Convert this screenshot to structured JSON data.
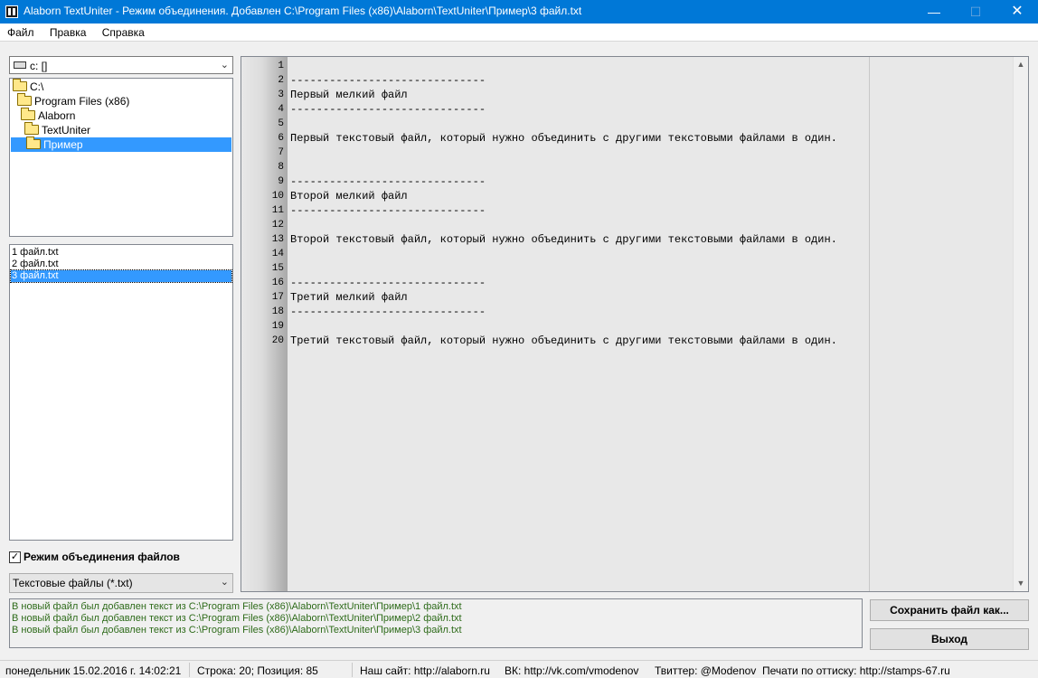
{
  "window": {
    "title": "Alaborn TextUniter - Режим объединения. Добавлен C:\\Program Files (x86)\\Alaborn\\TextUniter\\Пример\\3 файл.txt",
    "minimize": "—",
    "maximize": "☐",
    "close": "✕"
  },
  "menu": [
    "Файл",
    "Правка",
    "Справка"
  ],
  "drive": {
    "label": "c: []"
  },
  "dir_tree": [
    {
      "label": "C:\\",
      "selected": false
    },
    {
      "label": "Program Files (x86)",
      "selected": false
    },
    {
      "label": "Alaborn",
      "selected": false
    },
    {
      "label": "TextUniter",
      "selected": false
    },
    {
      "label": "Пример",
      "selected": true
    }
  ],
  "files": [
    {
      "label": "1 файл.txt",
      "selected": false
    },
    {
      "label": "2 файл.txt",
      "selected": false
    },
    {
      "label": "3 файл.txt",
      "selected": true
    }
  ],
  "merge_mode": {
    "label": "Режим объединения файлов",
    "checked": true,
    "mark": "✓"
  },
  "filter": {
    "value": "Текстовые файлы (*.txt)"
  },
  "editor": {
    "line_numbers": [
      "1",
      "2",
      "3",
      "4",
      "5",
      "6",
      "7",
      "8",
      "9",
      "10",
      "11",
      "12",
      "13",
      "14",
      "15",
      "16",
      "17",
      "18",
      "19",
      "20"
    ],
    "lines": [
      "",
      "------------------------------",
      "Первый мелкий файл",
      "------------------------------",
      "",
      "Первый текстовый файл, который нужно объединить с другими текстовыми файлами в один.",
      "",
      "",
      "------------------------------",
      "Второй мелкий файл",
      "------------------------------",
      "",
      "Второй текстовый файл, который нужно объединить с другими текстовыми файлами в один.",
      "",
      "",
      "------------------------------",
      "Третий мелкий файл",
      "------------------------------",
      "",
      "Третий текстовый файл, который нужно объединить с другими текстовыми файлами в один."
    ]
  },
  "log": [
    "В новый файл был добавлен текст из C:\\Program Files (x86)\\Alaborn\\TextUniter\\Пример\\1 файл.txt",
    "В новый файл был добавлен текст из C:\\Program Files (x86)\\Alaborn\\TextUniter\\Пример\\2 файл.txt",
    "В новый файл был добавлен текст из C:\\Program Files (x86)\\Alaborn\\TextUniter\\Пример\\3 файл.txt"
  ],
  "buttons": {
    "save": "Сохранить файл как...",
    "exit": "Выход"
  },
  "status": {
    "datetime": "понедельник 15.02.2016 г. 14:02:21",
    "position": "Строка: 20;  Позиция: 85",
    "site": "Наш сайт: http://alaborn.ru",
    "vk": "ВК: http://vk.com/vmodenov",
    "twitter": "Твиттер: @Modenov",
    "stamps": "Печати по оттиску: http://stamps-67.ru"
  }
}
